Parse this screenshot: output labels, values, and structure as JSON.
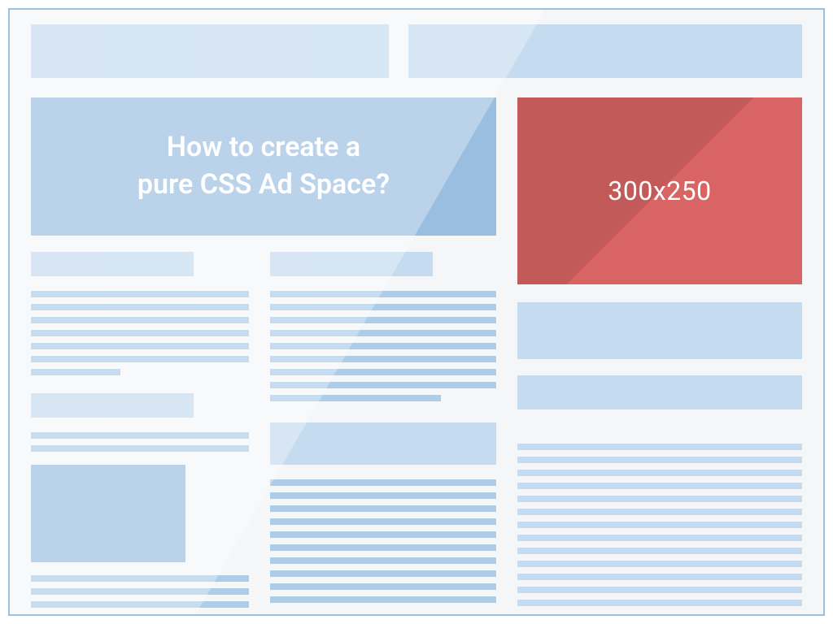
{
  "hero": {
    "line1": "How to create a",
    "line2": "pure CSS Ad Space?"
  },
  "ad": {
    "size_label": "300x250"
  },
  "colors": {
    "frame_border": "#9ABFE0",
    "page_bg": "#F4F6F8",
    "block_light": "#C5DBEF",
    "block_mid": "#ACCCE8",
    "block": "#99BEE0",
    "ad_bg": "#D86464",
    "text_white": "#FFFFFF"
  }
}
